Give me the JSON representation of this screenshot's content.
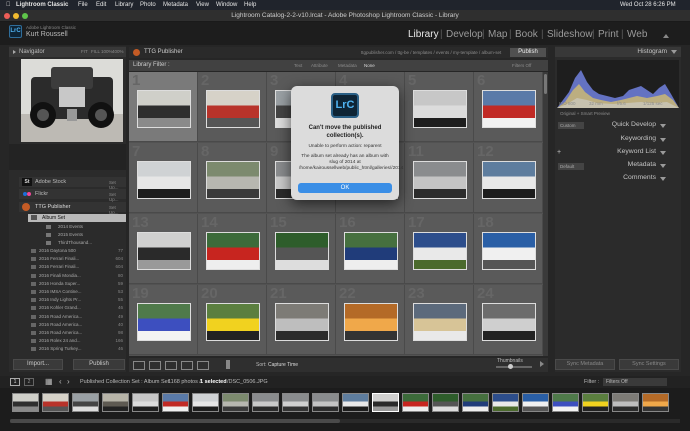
{
  "menubar": {
    "app_name": "Lightroom Classic",
    "items": [
      "File",
      "Edit",
      "Library",
      "Photo",
      "Metadata",
      "View",
      "Window",
      "Help"
    ],
    "clock": "Wed Oct 28  6:26 PM"
  },
  "window": {
    "title": "Lightroom Catalog-2-2-v10.lrcat - Adobe Photoshop Lightroom Classic - Library"
  },
  "identity": {
    "line1": "Adobe Lightroom Classic",
    "line2": "Kurt Roussell",
    "badge": "LrC"
  },
  "modules": [
    "Library",
    "Develop",
    "Map",
    "Book",
    "Slideshow",
    "Print",
    "Web"
  ],
  "left_panel": {
    "navigator_title": "Navigator",
    "navigator_options": [
      "FIT",
      "FILL",
      "100%",
      "400%"
    ],
    "services": [
      {
        "badge": "St",
        "name": "Adobe Stock",
        "action": "Set Up..."
      },
      {
        "badge": "",
        "name": "Flickr",
        "action": "Set Up..."
      },
      {
        "badge": "",
        "name": "TTG Publisher",
        "action": "Set Up..."
      }
    ],
    "album_set_label": "Album Set",
    "sub_events": [
      "2014 Events",
      "2015 Events",
      "ThirdThousand..."
    ],
    "collections": [
      {
        "name": "2016 Daytona 500",
        "count": "77"
      },
      {
        "name": "2016 Ferrari Finali...",
        "count": "604"
      },
      {
        "name": "2016 Ferrari Finali...",
        "count": "604"
      },
      {
        "name": "2016 Finali Mondia...",
        "count": "80"
      },
      {
        "name": "2016 Honda Super...",
        "count": "59"
      },
      {
        "name": "2016 IMSA Contine...",
        "count": "53"
      },
      {
        "name": "2016 Indy Lights Pr...",
        "count": "55"
      },
      {
        "name": "2016 Kohler Grand...",
        "count": "46"
      },
      {
        "name": "2016 Road America...",
        "count": "49"
      },
      {
        "name": "2016 Road America...",
        "count": "40"
      },
      {
        "name": "2016 Road America...",
        "count": "98"
      },
      {
        "name": "2016 Rolex 24 and...",
        "count": "166"
      },
      {
        "name": "2016 Spring Turkey...",
        "count": "46"
      }
    ],
    "import_label": "Import...",
    "publish_label": "Publish"
  },
  "center": {
    "publisher_title": "TTG Publisher",
    "path": "ttgpublisher.com / ttg-be / templates / events / my-template / album-set",
    "publish_button": "Publish",
    "filter_title": "Library Filter :",
    "filter_tabs": [
      "Text",
      "Attribute",
      "Metadata",
      "None"
    ],
    "filter_state": "Filters Off",
    "toolbar_sort_label": "Sort:",
    "toolbar_sort_value": "Capture Time",
    "thumbnails_label": "Thumbnails"
  },
  "dialog": {
    "title": "Can't move the published collection(s).",
    "subtitle": "Unable to perform action: reparent",
    "message": "The album set already has an album with slug of 2014 at /home/kairoussellweb/public_html/galleries//2014",
    "ok": "OK",
    "icon_text": "LrC"
  },
  "right_panel": {
    "histogram_title": "Histogram",
    "hist_info": [
      "ISO 800",
      "32 mm",
      "f/5.6",
      "1/125 sec"
    ],
    "smart_preview": "Original + Smart Preview",
    "quick_develop": "Quick Develop",
    "custom_label": "Custom",
    "keywording": "Keywording",
    "keyword_list": "Keyword List",
    "metadata": "Metadata",
    "default_label": "Default",
    "comments": "Comments",
    "sync_metadata": "Sync Metadata",
    "sync_settings": "Sync Settings"
  },
  "filmstrip_bar": {
    "pages": [
      "1",
      "2"
    ],
    "breadcrumb": "Published Collection Set : Album Set",
    "count_text": "1168 photos /",
    "selected_text": "1 selected",
    "file_text": "/DSC_0506.JPG",
    "filter_label": "Filter :",
    "filter_value": "Filters Off"
  },
  "grid_numbers": [
    1,
    2,
    3,
    4,
    5,
    6,
    7,
    8,
    9,
    10,
    11,
    12,
    13,
    14,
    15,
    16,
    17,
    18,
    19,
    20,
    21,
    22,
    23,
    24
  ],
  "colors": {
    "accent": "#3a8ee6",
    "badge_blue": "#4fb2f0",
    "menubar": "#20242c"
  }
}
